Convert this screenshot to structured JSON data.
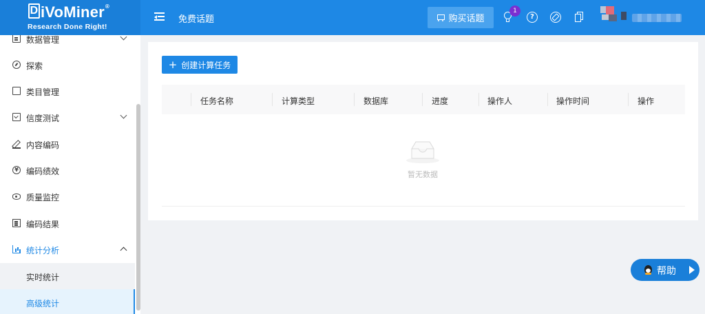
{
  "brand": {
    "name": "iVoMiner",
    "letter": "D",
    "tagline": "Research Done Right!",
    "reg": "®"
  },
  "header": {
    "title": "免费话题",
    "buy_button": "购买话题",
    "notification_count": "1",
    "help_glyph": "?",
    "icons": [
      "menu-toggle-icon",
      "lightbulb-icon",
      "help-circle-icon",
      "compass-icon",
      "copy-icon",
      "avatar"
    ]
  },
  "sidebar": {
    "items": [
      {
        "label": "数据管理",
        "icon": "document-icon",
        "expandable": true
      },
      {
        "label": "探索",
        "icon": "gauge-icon"
      },
      {
        "label": "类目管理",
        "icon": "page-icon"
      },
      {
        "label": "信度测试",
        "icon": "check-doc-icon",
        "expandable": true
      },
      {
        "label": "内容编码",
        "icon": "pen-icon"
      },
      {
        "label": "编码绩效",
        "icon": "yen-icon",
        "glyph": "¥"
      },
      {
        "label": "质量监控",
        "icon": "eye-icon"
      },
      {
        "label": "编码结果",
        "icon": "list-icon"
      },
      {
        "label": "统计分析",
        "icon": "bar-chart-icon",
        "expanded": true
      }
    ],
    "sub_items": [
      {
        "label": "实时统计"
      },
      {
        "label": "高级统计",
        "selected": true
      }
    ]
  },
  "main": {
    "create_button": "创建计算任务",
    "create_plus": "+",
    "columns": [
      "任务名称",
      "计算类型",
      "数据库",
      "进度",
      "操作人",
      "操作时间",
      "操作"
    ],
    "empty_text": "暂无数据"
  },
  "help_float": {
    "label": "帮助"
  },
  "colors": {
    "primary": "#1e88e5",
    "badge": "#7b2fd1",
    "bg": "#f0f2f5"
  }
}
